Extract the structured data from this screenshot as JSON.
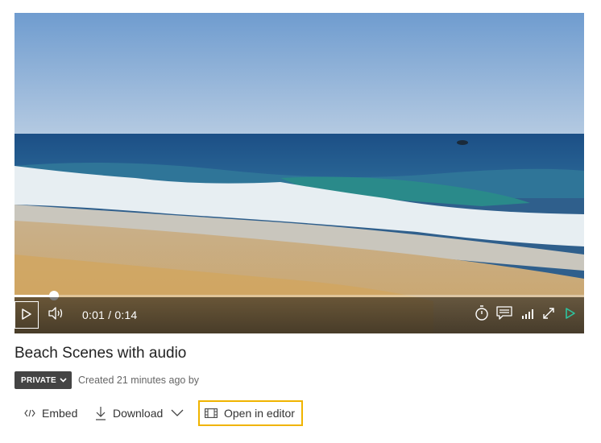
{
  "player": {
    "progress_fraction": 0.07,
    "current_time": "0:01",
    "separator": "/",
    "duration": "0:14",
    "icons": {
      "play": "play-icon",
      "volume": "volume-icon",
      "timer": "playback-speed-icon",
      "captions": "captions-icon",
      "quality": "quality-icon",
      "fullscreen": "fullscreen-icon",
      "next": "next-icon"
    },
    "accent_color": "#2ec4a0"
  },
  "video": {
    "title": "Beach Scenes with audio",
    "privacy": "PRIVATE",
    "created": "Created 21 minutes ago by"
  },
  "actions": {
    "embed": "Embed",
    "download": "Download",
    "open_editor": "Open in editor"
  },
  "highlight_color": "#f0b400"
}
